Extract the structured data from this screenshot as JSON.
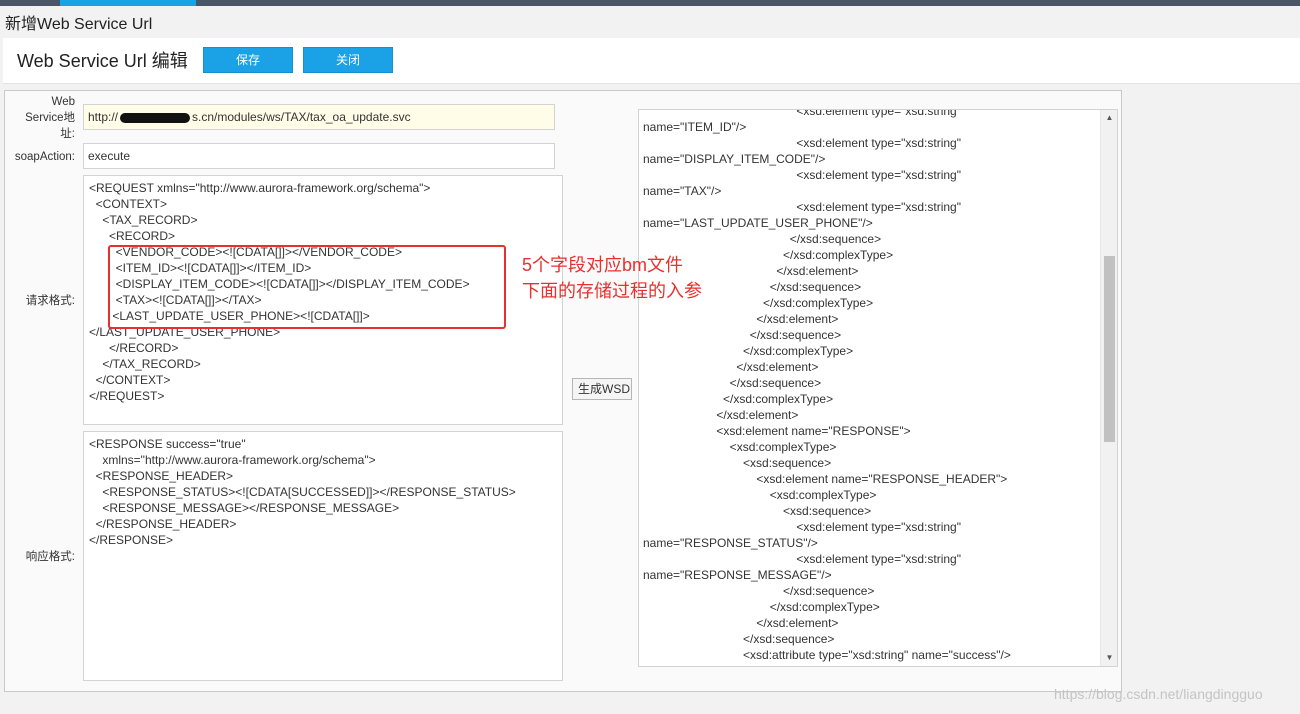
{
  "window": {
    "title": "新增Web Service Url"
  },
  "header": {
    "title": "Web Service Url 编辑",
    "save_label": "保存",
    "close_label": "关闭"
  },
  "form": {
    "url_label": "Web Service地址:",
    "url_prefix": "http://",
    "url_suffix": "s.cn/modules/ws/TAX/tax_oa_update.svc",
    "soap_label": "soapAction:",
    "soap_value": "execute",
    "request_label": "请求格式:",
    "response_label": "响应格式:",
    "request_xml": "<REQUEST xmlns=\"http://www.aurora-framework.org/schema\">\n  <CONTEXT>\n    <TAX_RECORD>\n      <RECORD>\n        <VENDOR_CODE><![CDATA[]]></VENDOR_CODE>\n        <ITEM_ID><![CDATA[]]></ITEM_ID>\n        <DISPLAY_ITEM_CODE><![CDATA[]]></DISPLAY_ITEM_CODE>\n        <TAX><![CDATA[]]></TAX>\n       <LAST_UPDATE_USER_PHONE><![CDATA[]]>\n</LAST_UPDATE_USER_PHONE>\n      </RECORD>\n    </TAX_RECORD>\n  </CONTEXT>\n</REQUEST>",
    "response_xml": "<RESPONSE success=\"true\"\n    xmlns=\"http://www.aurora-framework.org/schema\">\n  <RESPONSE_HEADER>\n    <RESPONSE_STATUS><![CDATA[SUCCESSED]]></RESPONSE_STATUS>\n    <RESPONSE_MESSAGE></RESPONSE_MESSAGE>\n  </RESPONSE_HEADER>\n</RESPONSE>",
    "wsdl_button": "生成WSDL",
    "wsdl_xml": "                                              <xsd:element type=\"xsd:string\"\nname=\"ITEM_ID\"/>\n                                              <xsd:element type=\"xsd:string\"\nname=\"DISPLAY_ITEM_CODE\"/>\n                                              <xsd:element type=\"xsd:string\"\nname=\"TAX\"/>\n                                              <xsd:element type=\"xsd:string\"\nname=\"LAST_UPDATE_USER_PHONE\"/>\n                                            </xsd:sequence>\n                                          </xsd:complexType>\n                                        </xsd:element>\n                                      </xsd:sequence>\n                                    </xsd:complexType>\n                                  </xsd:element>\n                                </xsd:sequence>\n                              </xsd:complexType>\n                            </xsd:element>\n                          </xsd:sequence>\n                        </xsd:complexType>\n                      </xsd:element>\n                      <xsd:element name=\"RESPONSE\">\n                          <xsd:complexType>\n                              <xsd:sequence>\n                                  <xsd:element name=\"RESPONSE_HEADER\">\n                                      <xsd:complexType>\n                                          <xsd:sequence>\n                                              <xsd:element type=\"xsd:string\"\nname=\"RESPONSE_STATUS\"/>\n                                              <xsd:element type=\"xsd:string\"\nname=\"RESPONSE_MESSAGE\"/>\n                                          </xsd:sequence>\n                                      </xsd:complexType>\n                                  </xsd:element>\n                              </xsd:sequence>\n                              <xsd:attribute type=\"xsd:string\" name=\"success\"/>\n                          </xsd:complexType>"
  },
  "annotation": {
    "text": "5个字段对应bm文件\n下面的存储过程的入参",
    "color": "#e8302e"
  },
  "watermark": "https://blog.csdn.net/liangdingguo",
  "colors": {
    "accent": "#1aa1e6",
    "topbar": "#4a5566",
    "url_field_bg": "#fffde8"
  },
  "icons": {
    "scroll_up": "scroll-up-arrow-icon",
    "scroll_down": "scroll-down-arrow-icon"
  }
}
